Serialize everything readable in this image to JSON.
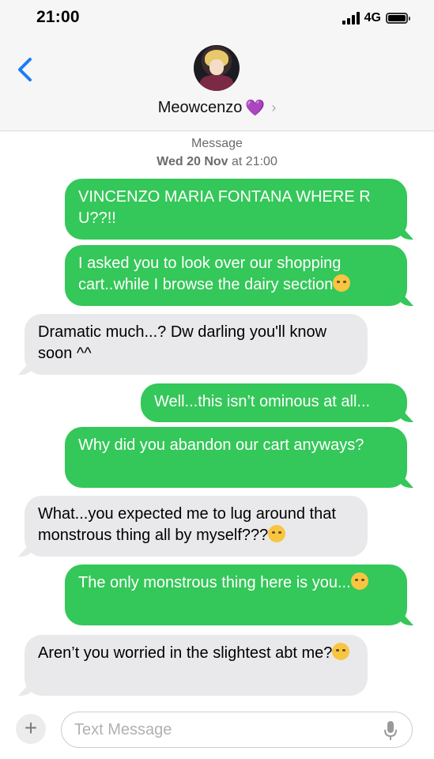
{
  "status_bar": {
    "time": "21:00",
    "network": "4G"
  },
  "header": {
    "contact_name": "Meowcenzo",
    "contact_emoji": "💜",
    "chevron": "›"
  },
  "thread_meta": {
    "line1": "Message",
    "date_bold": "Wed 20 Nov",
    "time_text": "at 21:00"
  },
  "messages": [
    {
      "direction": "outgoing",
      "text": "VINCENZO MARIA FONTANA WHERE R U??!!"
    },
    {
      "direction": "outgoing",
      "text": "I asked you to look over our shopping cart..while I browse the dairy section",
      "emoji": "expressionless-face-icon"
    },
    {
      "direction": "incoming",
      "text": "Dramatic much...? Dw darling you'll know soon ^^"
    },
    {
      "direction": "outgoing",
      "text": "Well...this isn’t ominous at all..."
    },
    {
      "direction": "outgoing",
      "text": "Why did you abandon our cart anyways?"
    },
    {
      "direction": "incoming",
      "text": "What...you expected me to lug around that monstrous thing all by myself???",
      "emoji": "eye-roll-face-icon"
    },
    {
      "direction": "outgoing",
      "text": "The only monstrous thing here is you...",
      "emoji": "slight-smile-face-icon"
    },
    {
      "direction": "incoming",
      "text": "Aren’t you worried in the slightest abt me?",
      "emoji": "pleading-face-icon"
    }
  ],
  "composer": {
    "placeholder": "Text Message",
    "plus_label": "+"
  },
  "colors": {
    "outgoing": "#34c759",
    "incoming": "#e9e9eb",
    "back_arrow": "#1a7cf5"
  }
}
